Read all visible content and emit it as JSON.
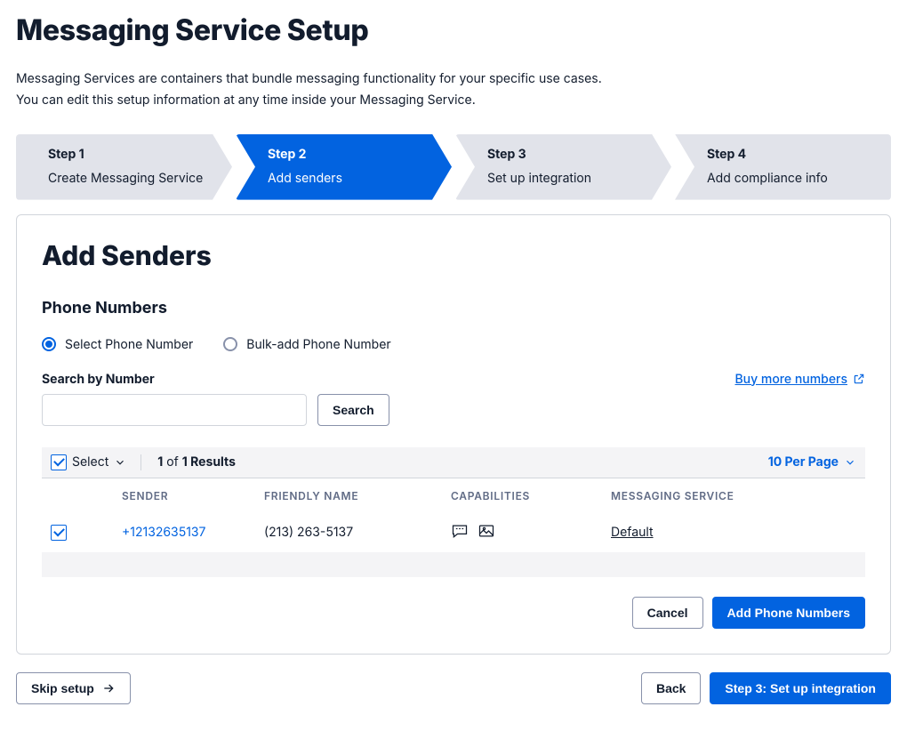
{
  "header": {
    "title": "Messaging Service Setup",
    "intro_line1": "Messaging Services are containers that bundle messaging functionality for your specific use cases.",
    "intro_line2": "You can edit this setup information at any time inside your Messaging Service."
  },
  "stepper": {
    "steps": [
      {
        "step_label": "Step 1",
        "desc": "Create Messaging Service",
        "active": false
      },
      {
        "step_label": "Step 2",
        "desc": "Add senders",
        "active": true
      },
      {
        "step_label": "Step 3",
        "desc": "Set up integration",
        "active": false
      },
      {
        "step_label": "Step 4",
        "desc": "Add compliance info",
        "active": false
      }
    ]
  },
  "panel": {
    "heading": "Add Senders",
    "section": "Phone Numbers",
    "radios": {
      "select_label": "Select Phone Number",
      "bulk_label": "Bulk-add Phone Number",
      "selected": "select"
    },
    "search": {
      "label": "Search by Number",
      "value": "",
      "button": "Search"
    },
    "buy_link_text": "Buy more numbers",
    "table": {
      "select_label": "Select",
      "results_selected": "1",
      "results_of": "of",
      "results_total": "1 Results",
      "per_page": "10 Per Page",
      "cols": {
        "sender": "SENDER",
        "friendly": "FRIENDLY NAME",
        "caps": "CAPABILITIES",
        "service": "MESSAGING SERVICE"
      },
      "rows": [
        {
          "checked": true,
          "sender": "+12132635137",
          "friendly": "(213) 263-5137",
          "caps_sms": true,
          "caps_mms": true,
          "service": "Default"
        }
      ]
    },
    "footer": {
      "cancel": "Cancel",
      "add": "Add Phone Numbers"
    }
  },
  "page_footer": {
    "skip": "Skip setup",
    "back": "Back",
    "next": "Step 3: Set up integration"
  }
}
